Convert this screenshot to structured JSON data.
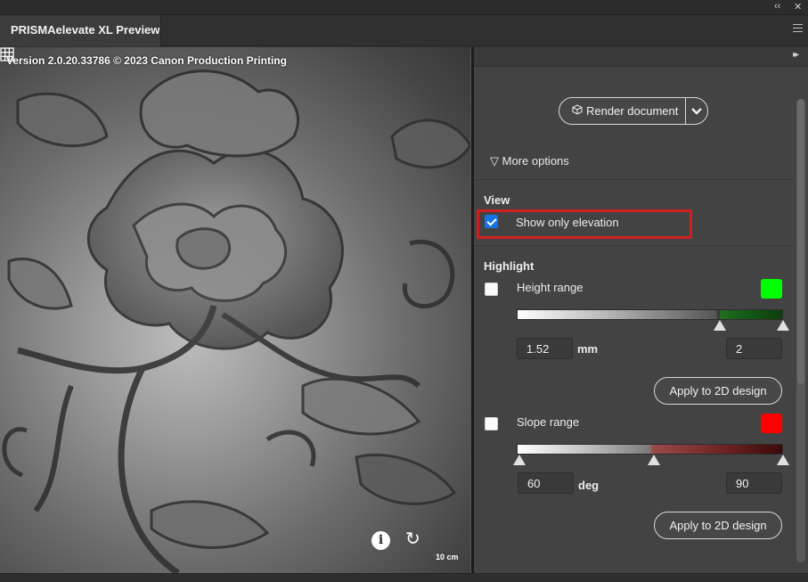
{
  "window": {
    "collapse_glyph": "‹‹",
    "close_glyph": "✕",
    "tab_title": "PRISMAelevate XL Preview"
  },
  "preview": {
    "version_text": "Version 2.0.20.33786 © 2023 Canon Production Printing",
    "scale_label": "10 cm",
    "icons": [
      "info-icon",
      "reset-view-icon",
      "grid-icon"
    ]
  },
  "panel": {
    "expand_glyph": "▸▸",
    "render_button_label": "Render document",
    "more_options_label": "More options",
    "view": {
      "title": "View",
      "show_only_elevation_label": "Show only elevation",
      "show_only_elevation_checked": true
    },
    "highlight": {
      "title": "Highlight",
      "height_range": {
        "label": "Height range",
        "checked": false,
        "color": "#00ff00",
        "min_value": "1.52",
        "unit": "mm",
        "max_value": "2",
        "low_handle_fraction": 0.76,
        "high_handle_fraction": 1.0,
        "apply_label": "Apply to 2D design"
      },
      "slope_range": {
        "label": "Slope range",
        "checked": false,
        "color": "#ff0000",
        "min_value": "60",
        "unit": "deg",
        "max_value": "90",
        "low_handle_fraction": 0.0,
        "mid_handle_fraction": 0.5,
        "high_handle_fraction": 1.0,
        "apply_label": "Apply to 2D design"
      }
    }
  }
}
